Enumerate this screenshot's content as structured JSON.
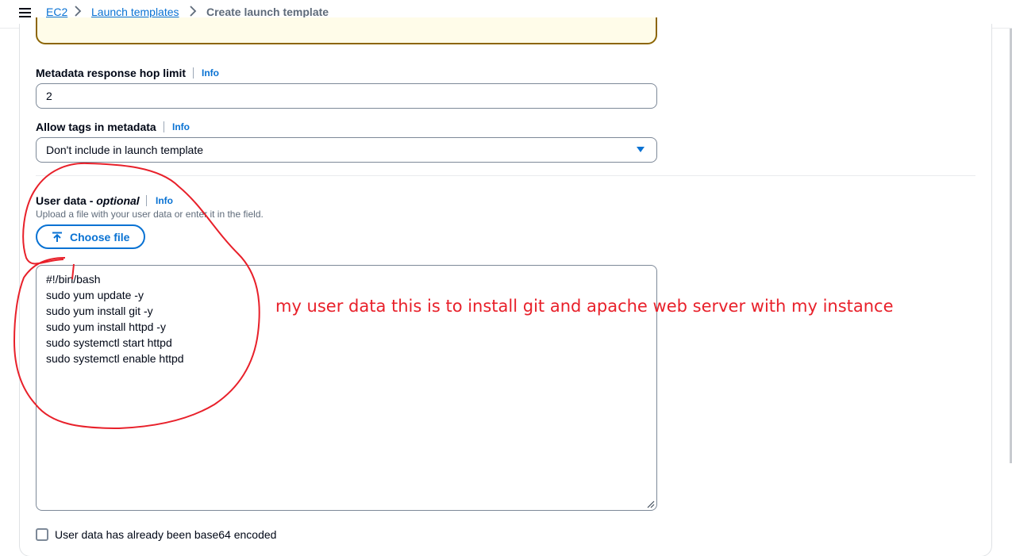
{
  "breadcrumb": {
    "items": [
      "EC2",
      "Launch templates"
    ],
    "current": "Create launch template"
  },
  "hop_limit": {
    "label": "Metadata response hop limit",
    "info": "Info",
    "value": "2"
  },
  "allow_tags": {
    "label": "Allow tags in metadata",
    "info": "Info",
    "selected": "Don't include in launch template"
  },
  "user_data": {
    "label": "User data - ",
    "label_optional": "optional",
    "info": "Info",
    "description": "Upload a file with your user data or enter it in the field.",
    "choose_file": "Choose file",
    "lines": [
      "#!/bin/bash",
      "sudo yum update -y",
      "sudo yum install git -y",
      "sudo yum install httpd -y",
      "sudo systemctl start httpd",
      "sudo systemctl enable httpd"
    ]
  },
  "base64_checkbox": {
    "label": "User data has already been base64 encoded",
    "checked": false
  },
  "annotation": {
    "text": "my user data this is to install git and apache web server with my instance",
    "color": "#e8202a"
  },
  "colors": {
    "link": "#0972d3",
    "warning_border": "#8d6605",
    "warning_bg": "#fffce9"
  }
}
